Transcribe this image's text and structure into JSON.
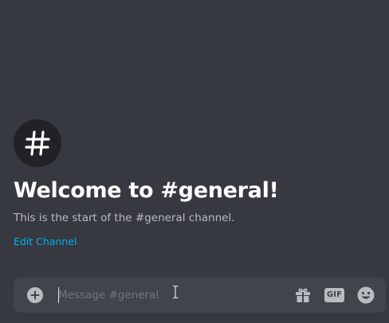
{
  "channel": {
    "welcome_title": "Welcome to #general!",
    "welcome_subtitle": "This is the start of the #general channel.",
    "edit_link": "Edit Channel"
  },
  "composer": {
    "placeholder": "Message #general",
    "value": "",
    "gif_label": "GIF"
  },
  "icons": {
    "channel": "hash-icon",
    "attach": "plus-circle-icon",
    "gift": "gift-icon",
    "emoji": "smiley-icon",
    "cursor": "text-cursor-icon"
  },
  "colors": {
    "background": "#36393f",
    "composer": "#40444b",
    "hash_circle": "#202225",
    "link": "#00aff4",
    "title": "#ffffff",
    "subtitle": "#b9bbbe",
    "placeholder": "#72767d",
    "icon": "#b9bbbe"
  }
}
